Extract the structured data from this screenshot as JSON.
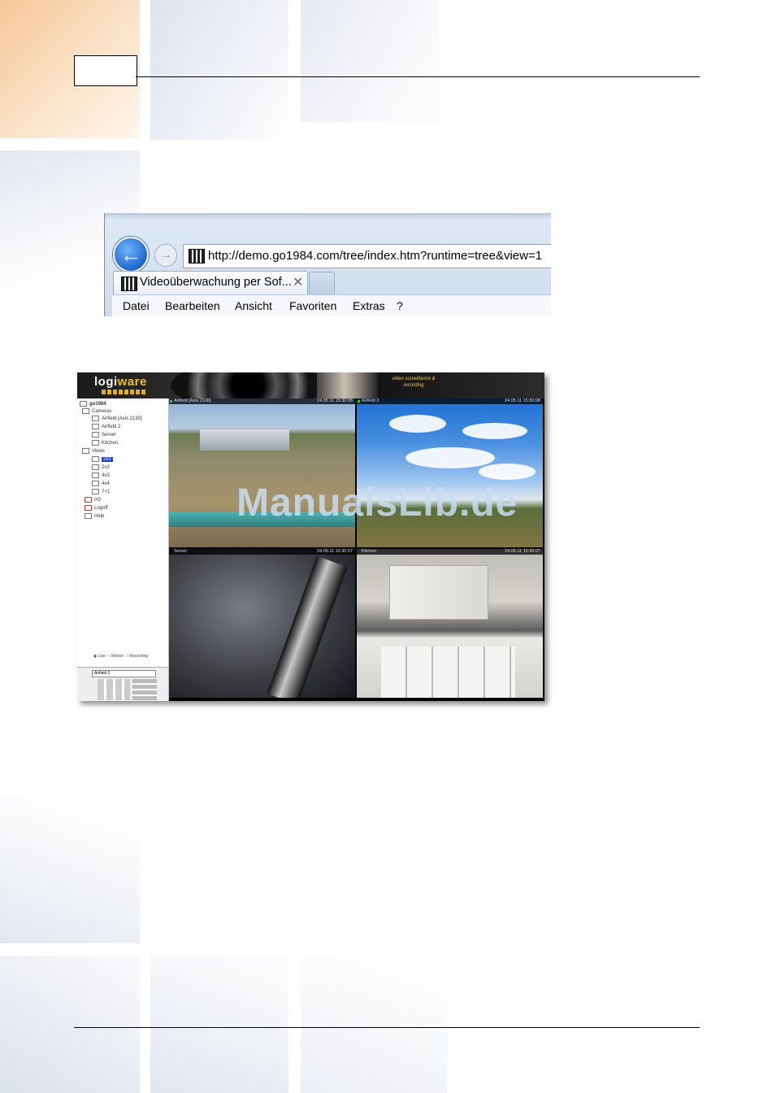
{
  "browser": {
    "url": "http://demo.go1984.com/tree/index.htm?runtime=tree&view=1",
    "tab_title": "Videoüberwachung per Sof...",
    "tab_close": "✕",
    "back_glyph": "←",
    "forward_glyph": "→",
    "menu": [
      "Datei",
      "Bearbeiten",
      "Ansicht",
      "Favoriten",
      "Extras",
      "?"
    ]
  },
  "app": {
    "logo_main": "logi",
    "logo_accent": "ware",
    "tagline": "video surveillance & recording",
    "tree": {
      "root": "go1984",
      "cameras_label": "Cameras",
      "cameras": [
        "Airfield [Axis 2130]",
        "Airfield 2",
        "Server",
        "Kitchen"
      ],
      "views_label": "Views",
      "views": [
        "2x2",
        "2x3",
        "4x3",
        "4x4",
        "7+1"
      ],
      "selected_view_index": 0,
      "io": "I/O",
      "logoff": "Logoff",
      "help": "Help"
    },
    "modes": [
      "Live",
      "Motion",
      "Recording"
    ],
    "ptz_camera": "Airfield 2",
    "cameras_grid": [
      {
        "name": "Airfield [Axis 2130]",
        "time": "24.05.11 15:30:08"
      },
      {
        "name": "Airfield 2",
        "time": "24.05.11 15:30:08"
      },
      {
        "name": "Server",
        "time": "24.05.11 15:30:07"
      },
      {
        "name": "Kitchen",
        "time": "24.05.11 15:30:07"
      }
    ],
    "watermark": "ManualsLib.de"
  }
}
